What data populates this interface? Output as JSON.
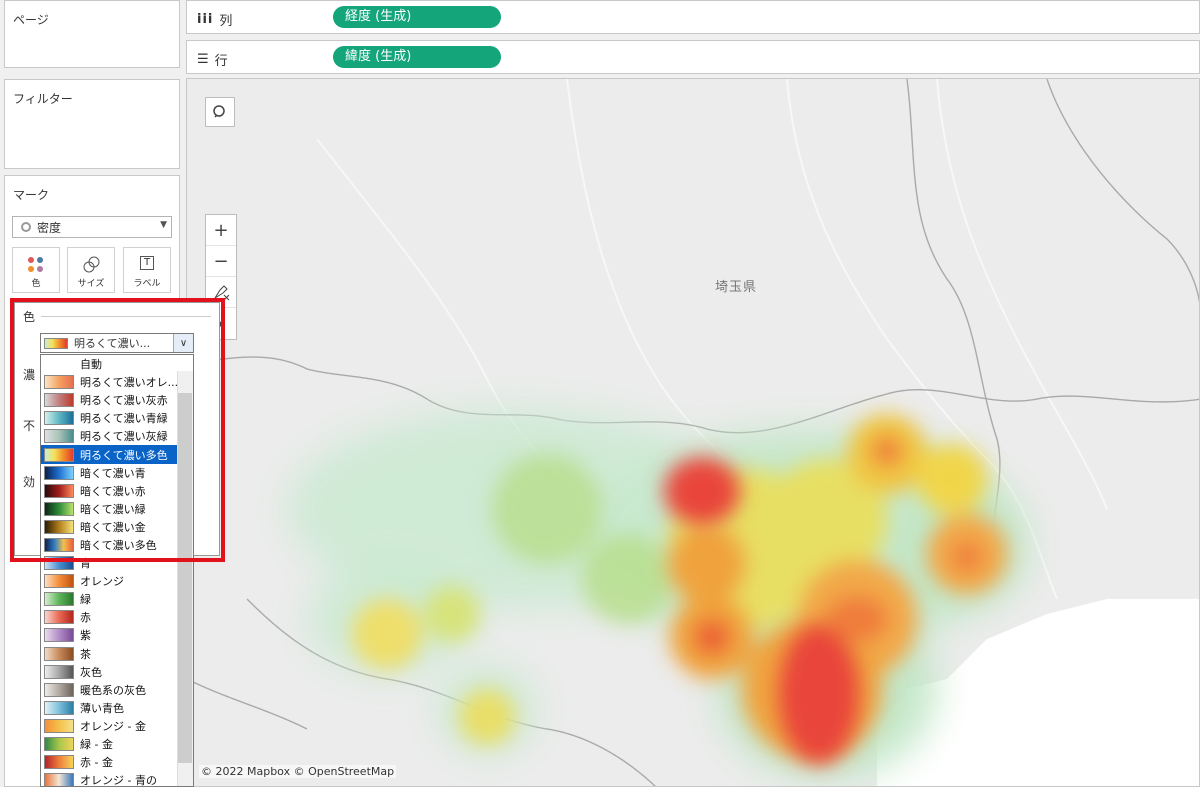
{
  "shelves": {
    "pages_label": "ページ",
    "columns": {
      "label": "列",
      "pill": "経度 (生成)"
    },
    "rows": {
      "label": "行",
      "pill": "緯度 (生成)"
    }
  },
  "filters": {
    "label": "フィルター"
  },
  "marks": {
    "label": "マーク",
    "type_value": "密度",
    "buttons": {
      "color": "色",
      "size": "サイズ",
      "label": "ラベル"
    }
  },
  "color_popup": {
    "title": "色",
    "combo_value": "明るくて濃い...",
    "hidden_labels": {
      "intensity": "濃",
      "opacity": "不",
      "effect": "効"
    },
    "items": [
      {
        "label": "自動",
        "swatch": ""
      },
      {
        "label": "明るくて濃いオレ...",
        "swatch": "linear-gradient(90deg,#fde5c8,#f4a261,#e76f51)"
      },
      {
        "label": "明るくて濃い灰赤",
        "swatch": "linear-gradient(90deg,#d9d9d9,#c08080,#c0392b)"
      },
      {
        "label": "明るくて濃い青緑",
        "swatch": "linear-gradient(90deg,#d4f0ec,#5fb7c4,#1b6f9b)"
      },
      {
        "label": "明るくて濃い灰緑",
        "swatch": "linear-gradient(90deg,#e0e0e0,#a9c3b8,#4a8c8c)"
      },
      {
        "label": "明るくて濃い多色",
        "swatch": "linear-gradient(90deg,#c7ecd5,#f4e25a,#f28c28,#e03c31)",
        "selected": true
      },
      {
        "label": "暗くて濃い青",
        "swatch": "linear-gradient(90deg,#0b1f4a,#1f6fd1,#7ad1ff)"
      },
      {
        "label": "暗くて濃い赤",
        "swatch": "linear-gradient(90deg,#2a0a0a,#a01c1c,#ff8a5c)"
      },
      {
        "label": "暗くて濃い緑",
        "swatch": "linear-gradient(90deg,#0c2612,#2e8b3a,#b6e36a)"
      },
      {
        "label": "暗くて濃い金",
        "swatch": "linear-gradient(90deg,#2a1c05,#b07d1a,#f7e37a)"
      },
      {
        "label": "暗くて濃い多色",
        "swatch": "linear-gradient(90deg,#12204a,#2e7bc4,#f2c14e,#e8603c)"
      },
      {
        "label": "青",
        "swatch": "linear-gradient(90deg,#cfe3f5,#4a8fd0,#1a4f91)"
      },
      {
        "label": "オレンジ",
        "swatch": "linear-gradient(90deg,#fde0c2,#f68d3c,#c2520f)"
      },
      {
        "label": "緑",
        "swatch": "linear-gradient(90deg,#d6efcf,#5fb55a,#2a7a2e)"
      },
      {
        "label": "赤",
        "swatch": "linear-gradient(90deg,#fbd6d0,#ea6a55,#b3261e)"
      },
      {
        "label": "紫",
        "swatch": "linear-gradient(90deg,#eadcef,#b18cc6,#7a4b97)"
      },
      {
        "label": "茶",
        "swatch": "linear-gradient(90deg,#f1dcc8,#c98a5a,#8a4e25)"
      },
      {
        "label": "灰色",
        "swatch": "linear-gradient(90deg,#eeeeee,#a6a6a6,#555555)"
      },
      {
        "label": "暖色系の灰色",
        "swatch": "linear-gradient(90deg,#efece8,#b2aba3,#6d645b)"
      },
      {
        "label": "薄い青色",
        "swatch": "linear-gradient(90deg,#e3f2f8,#7fc0dc,#2b7ea6)"
      },
      {
        "label": "オレンジ - 金",
        "swatch": "linear-gradient(90deg,#f3903a,#f5c04a,#f4e08a)"
      },
      {
        "label": "緑 - 金",
        "swatch": "linear-gradient(90deg,#2f8a4a,#a7c64b,#f2d45a)"
      },
      {
        "label": "赤 - 金",
        "swatch": "linear-gradient(90deg,#b4232a,#ee7d3b,#f6d35b)"
      },
      {
        "label": "オレンジ - 青の",
        "swatch": "linear-gradient(90deg,#e8743b,#f2e6d6,#3b78b8)"
      }
    ]
  },
  "map": {
    "prefecture_label": "埼玉県",
    "attribution": "© 2022 Mapbox © OpenStreetMap",
    "tools": [
      "search-icon",
      "zoom-in-icon",
      "zoom-out-icon",
      "pin-reset-icon",
      "expand-icon"
    ]
  }
}
